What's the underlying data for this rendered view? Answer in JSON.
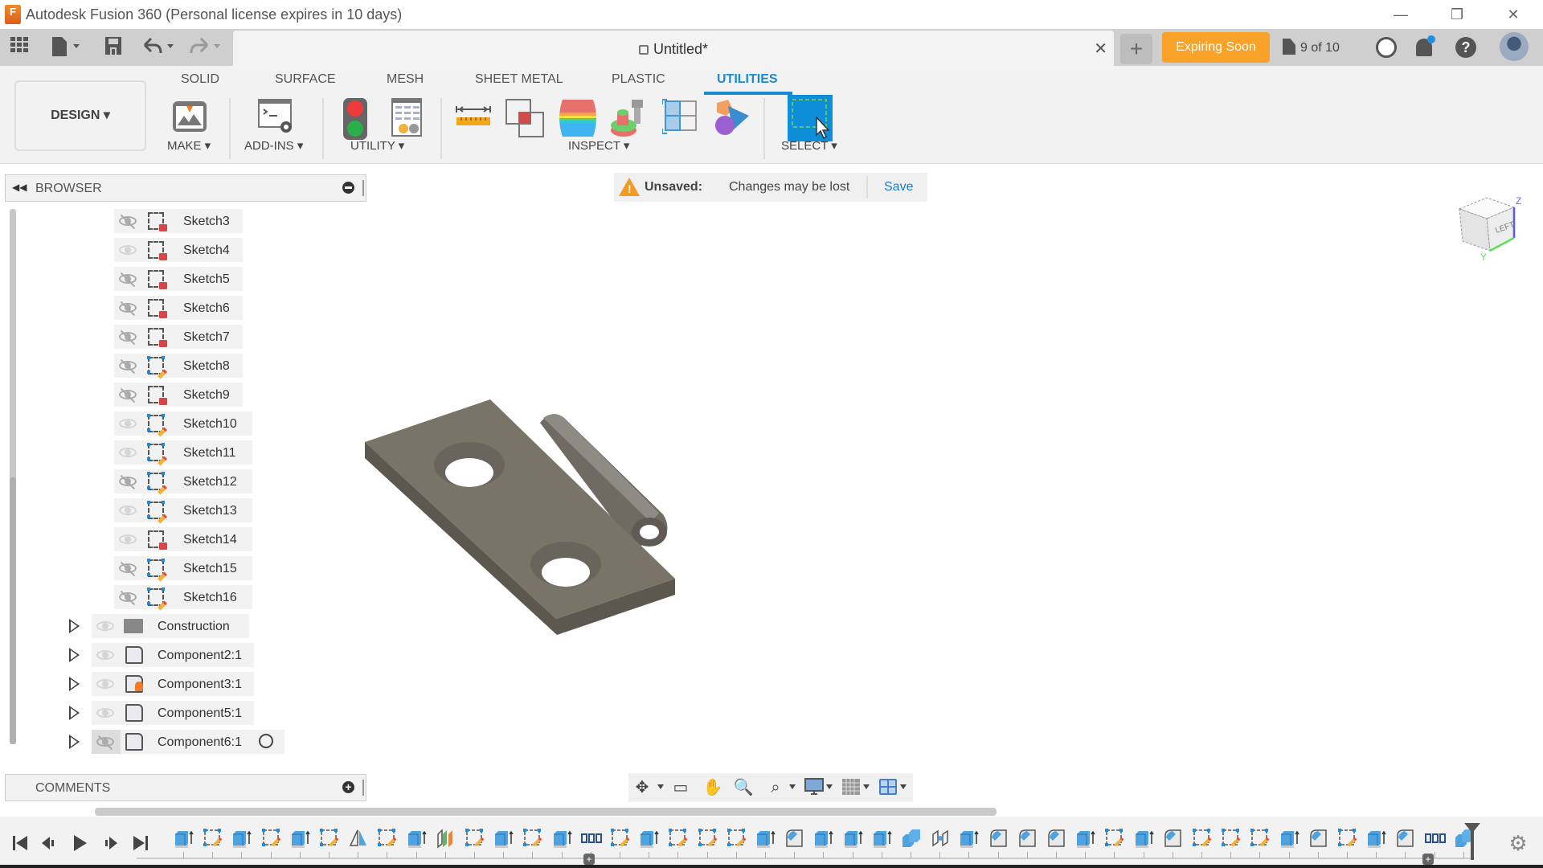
{
  "window": {
    "title": "Autodesk Fusion 360 (Personal license expires in 10 days)",
    "logo_letter": "F",
    "controls": {
      "minimize": "—",
      "restore": "❐",
      "close": "✕"
    }
  },
  "quick_access": {
    "icons": [
      "apps-grid-icon",
      "file-icon",
      "save-icon",
      "undo-icon",
      "redo-icon"
    ]
  },
  "document_tab": {
    "title": "Untitled*",
    "locked": true,
    "close_label": "✕"
  },
  "header_right": {
    "new_tab_label": "+",
    "expiring_label": "Expiring Soon",
    "jobs_label": "9 of 10",
    "help_label": "?",
    "notification_badge": true
  },
  "ribbon": {
    "workspace_label": "DESIGN ▾",
    "tabs": [
      {
        "label": "SOLID",
        "active": false
      },
      {
        "label": "SURFACE",
        "active": false
      },
      {
        "label": "MESH",
        "active": false
      },
      {
        "label": "SHEET METAL",
        "active": false
      },
      {
        "label": "PLASTIC",
        "active": false
      },
      {
        "label": "UTILITIES",
        "active": true
      }
    ],
    "groups": [
      {
        "label": "MAKE ▾",
        "tools": [
          "3d-print-icon"
        ]
      },
      {
        "label": "ADD-INS ▾",
        "tools": [
          "scripts-addins-icon"
        ]
      },
      {
        "label": "UTILITY ▾",
        "tools": [
          "traffic-light-icon",
          "parameters-table-icon"
        ]
      },
      {
        "label": "INSPECT ▾",
        "tools": [
          "measure-icon",
          "interference-icon",
          "curvature-comb-icon",
          "zebra-analysis-icon",
          "section-analysis-icon",
          "component-color-cycling-icon"
        ]
      },
      {
        "label": "SELECT ▾",
        "tools": [
          "window-select-icon"
        ]
      }
    ],
    "accent": "#1a8ad4"
  },
  "browser": {
    "title": "BROWSER",
    "sketches": [
      {
        "label": "Sketch3",
        "visible": false,
        "locked": true
      },
      {
        "label": "Sketch4",
        "visible": true,
        "locked": true
      },
      {
        "label": "Sketch5",
        "visible": false,
        "locked": true
      },
      {
        "label": "Sketch6",
        "visible": false,
        "locked": true
      },
      {
        "label": "Sketch7",
        "visible": false,
        "locked": true
      },
      {
        "label": "Sketch8",
        "visible": false,
        "locked": false
      },
      {
        "label": "Sketch9",
        "visible": false,
        "locked": true
      },
      {
        "label": "Sketch10",
        "visible": true,
        "locked": false
      },
      {
        "label": "Sketch11",
        "visible": true,
        "locked": false
      },
      {
        "label": "Sketch12",
        "visible": false,
        "locked": false
      },
      {
        "label": "Sketch13",
        "visible": true,
        "locked": false
      },
      {
        "label": "Sketch14",
        "visible": true,
        "locked": true
      },
      {
        "label": "Sketch15",
        "visible": false,
        "locked": false
      },
      {
        "label": "Sketch16",
        "visible": false,
        "locked": false
      }
    ],
    "nodes": [
      {
        "label": "Construction",
        "type": "folder",
        "visible": true
      },
      {
        "label": "Component2:1",
        "type": "component",
        "visible": true
      },
      {
        "label": "Component3:1",
        "type": "component-pinned",
        "visible": true
      },
      {
        "label": "Component5:1",
        "type": "component",
        "visible": true
      },
      {
        "label": "Component6:1",
        "type": "component",
        "visible": false,
        "activate_radio": true
      }
    ]
  },
  "unsaved_banner": {
    "label": "Unsaved:",
    "message": "Changes may be lost",
    "action": "Save"
  },
  "viewcube": {
    "face": "LEFT",
    "axes": {
      "z": "Z",
      "y": "Y"
    }
  },
  "comments": {
    "title": "COMMENTS",
    "add_label": "+"
  },
  "navbar": {
    "tools": [
      "orbit-icon",
      "look-at-icon",
      "pan-icon",
      "zoom-icon",
      "fit-icon",
      "display-settings-icon",
      "grid-snaps-icon",
      "viewports-icon"
    ]
  },
  "timeline": {
    "controls": [
      "go-to-start",
      "step-back",
      "play",
      "step-forward",
      "go-to-end"
    ],
    "features": [
      "extrude",
      "sketch",
      "extrude",
      "sketch",
      "extrude",
      "sketch",
      "mirror",
      "sketch",
      "extrude",
      "split-body",
      "sketch",
      "extrude",
      "sketch",
      "extrude",
      "pattern",
      "sketch",
      "extrude",
      "sketch",
      "sketch",
      "sketch",
      "extrude",
      "fillet",
      "extrude",
      "extrude",
      "extrude",
      "combine",
      "joint",
      "extrude",
      "fillet",
      "fillet",
      "fillet",
      "extrude",
      "sketch",
      "extrude",
      "fillet",
      "sketch",
      "sketch",
      "sketch",
      "extrude",
      "fillet",
      "sketch",
      "extrude",
      "fillet",
      "pattern",
      "combine"
    ]
  }
}
